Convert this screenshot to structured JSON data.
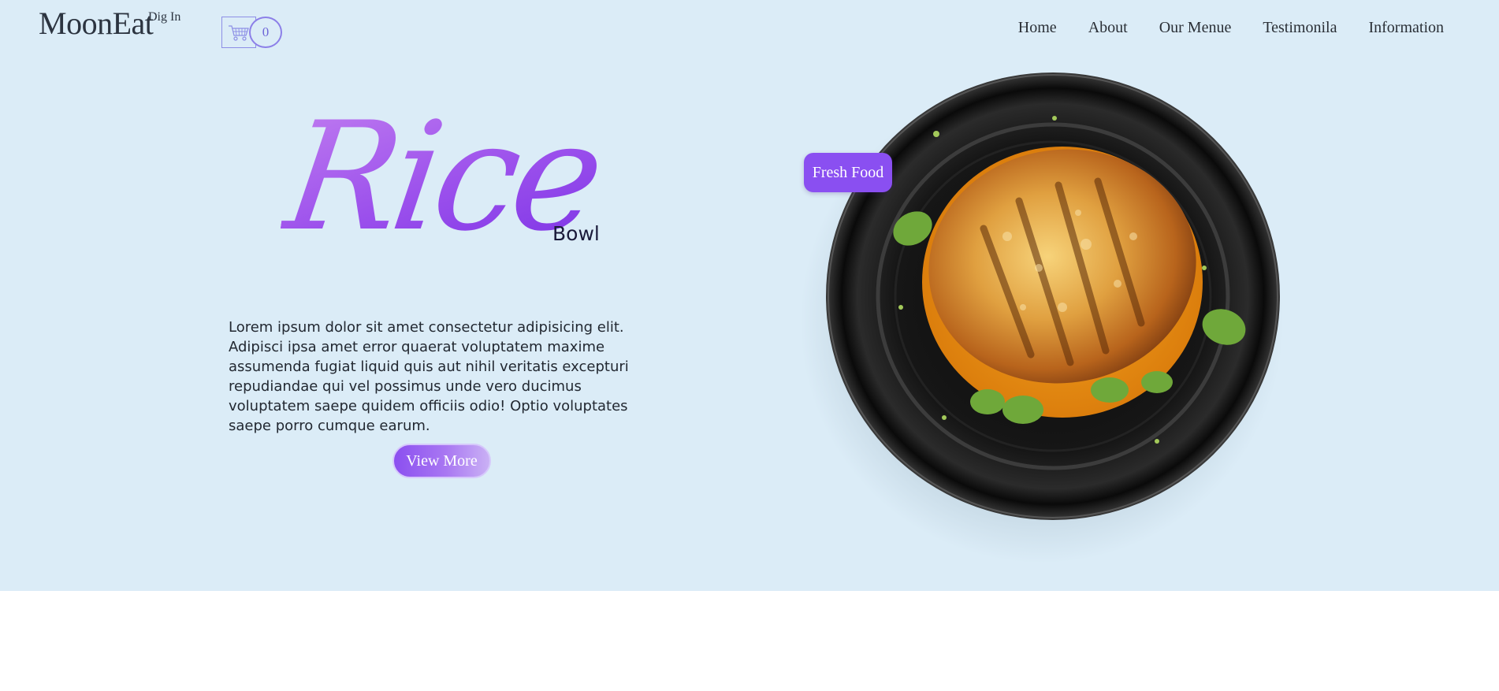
{
  "header": {
    "logo": "MoonEat",
    "logo_tagline": "Dig In",
    "cart_count": "0",
    "cart_icon": "cart-icon"
  },
  "nav": {
    "items": [
      "Home",
      "About",
      "Our Menue",
      "Testimonila",
      "Information"
    ]
  },
  "hero": {
    "title_script": "Rice",
    "title_small": "Bowl",
    "description": "Lorem ipsum dolor sit amet consectetur adipisicing elit. Adipisci ipsa amet error quaerat voluptatem maxime assumenda fugiat liquid quis aut nihil veritatis excepturi repudiandae qui vel possimus unde vero ducimus voluptatem saepe quidem officiis odio! Optio voluptates saepe porro cumque earum.",
    "button_label": "View More",
    "badge_label": "Fresh Food"
  },
  "colors": {
    "hero_background": "#dbecf7",
    "accent_purple": "#8a4ff1",
    "cart_outline": "#8d8ee6"
  }
}
